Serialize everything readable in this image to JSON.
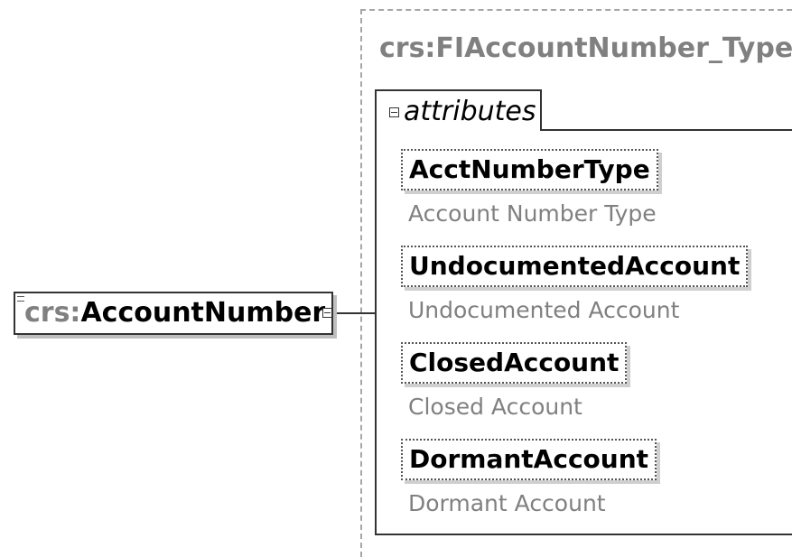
{
  "element": {
    "prefix": "crs:",
    "local_name": "AccountNumber"
  },
  "type": {
    "title": "crs:FIAccountNumber_Type",
    "attributes_label": "attributes",
    "attributes": [
      {
        "name": "AcctNumberType",
        "description": "Account Number Type"
      },
      {
        "name": "UndocumentedAccount",
        "description": "Undocumented Account"
      },
      {
        "name": "ClosedAccount",
        "description": "Closed Account"
      },
      {
        "name": "DormantAccount",
        "description": "Dormant Account"
      }
    ]
  }
}
